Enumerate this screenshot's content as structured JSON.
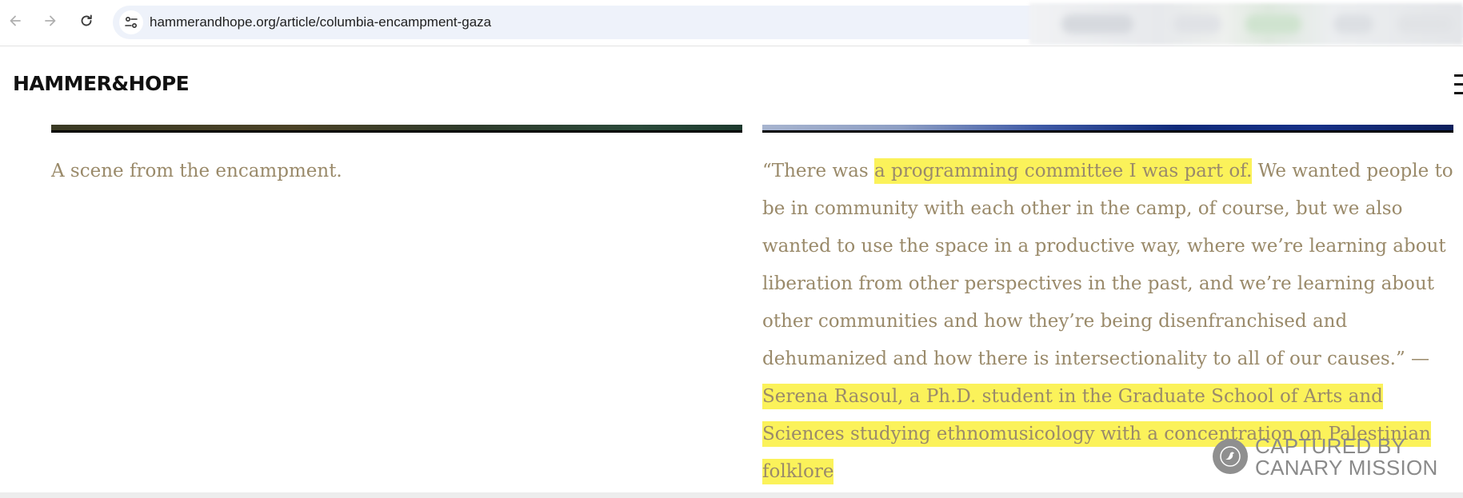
{
  "browser": {
    "url": "hammerandhope.org/article/columbia-encampment-gaza",
    "back_icon": "arrow-left-icon",
    "forward_icon": "arrow-right-icon",
    "reload_icon": "reload-icon",
    "site_info_icon": "tune-icon"
  },
  "site": {
    "logo": "HAMMER&HOPE",
    "menu_icon": "hamburger-menu-icon"
  },
  "captions": {
    "left": "A scene from the encampment.",
    "right": {
      "part1": "“There was ",
      "hl1": "a programming committee I was part of.",
      "part2": " We wanted people to be in community with each other in the camp, of course, but we also wanted to use the space in a productive way, where we’re learning about liberation from other perspectives in the past, and we’re learning about other communities and how they’re being disenfranchised and dehumanized and how there is intersectionality to all of our causes.” — ",
      "hl2": "Serena Rasoul, a Ph.D. student in the Graduate School of Arts and Sciences studying ethnomusicology with a concentration on Palestinian folklore"
    }
  },
  "watermark": {
    "line1": "CAPTURED BY",
    "line2": "CANARY MISSION"
  },
  "colors": {
    "caption_text": "#9a8a6a",
    "highlight": "#fbf25a",
    "omnibox_bg": "#eef2fa"
  }
}
